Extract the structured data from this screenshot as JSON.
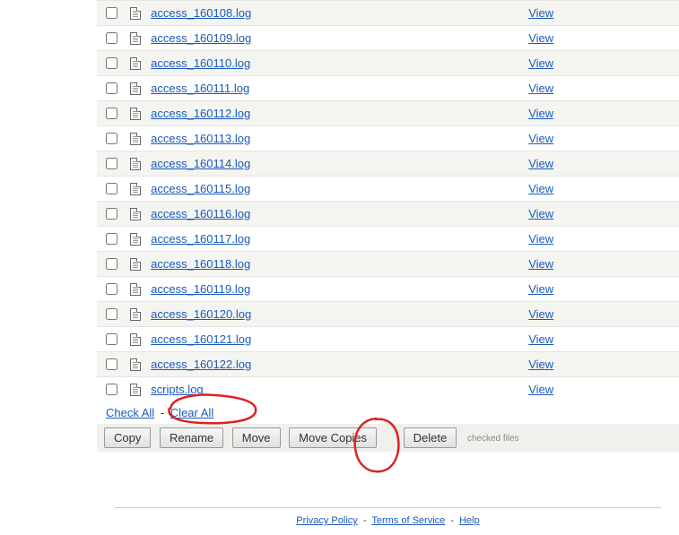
{
  "files": [
    {
      "name": "access_160108.log",
      "view": "View"
    },
    {
      "name": "access_160109.log",
      "view": "View"
    },
    {
      "name": "access_160110.log",
      "view": "View"
    },
    {
      "name": "access_160111.log",
      "view": "View"
    },
    {
      "name": "access_160112.log",
      "view": "View"
    },
    {
      "name": "access_160113.log",
      "view": "View"
    },
    {
      "name": "access_160114.log",
      "view": "View"
    },
    {
      "name": "access_160115.log",
      "view": "View"
    },
    {
      "name": "access_160116.log",
      "view": "View"
    },
    {
      "name": "access_160117.log",
      "view": "View"
    },
    {
      "name": "access_160118.log",
      "view": "View"
    },
    {
      "name": "access_160119.log",
      "view": "View"
    },
    {
      "name": "access_160120.log",
      "view": "View"
    },
    {
      "name": "access_160121.log",
      "view": "View"
    },
    {
      "name": "access_160122.log",
      "view": "View"
    },
    {
      "name": "scripts.log",
      "view": "View"
    }
  ],
  "checkline": {
    "check_all": "Check All",
    "sep": "-",
    "clear_all": "Clear All"
  },
  "buttons": {
    "copy": "Copy",
    "rename": "Rename",
    "move": "Move",
    "move_copies": "Move Copies",
    "delete": "Delete",
    "checked_files": "checked files"
  },
  "footer": {
    "privacy": "Privacy Policy",
    "tos": "Terms of Service",
    "help": "Help",
    "dash": "-"
  },
  "annotation_color": "#d22"
}
